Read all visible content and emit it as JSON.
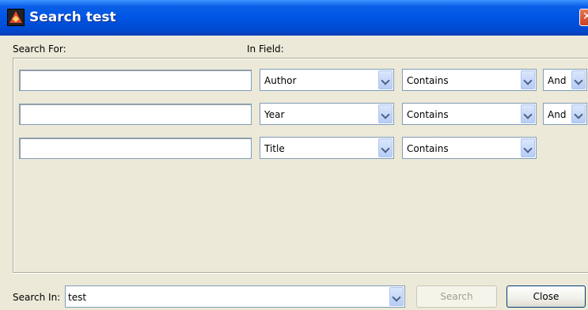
{
  "window": {
    "title": "Search test",
    "close_glyph": "✕"
  },
  "labels": {
    "search_for": "Search For:",
    "in_field": "In Field:",
    "search_in": "Search In:"
  },
  "criteria": [
    {
      "search_text": "",
      "field": "Author",
      "condition": "Contains",
      "connector": "And"
    },
    {
      "search_text": "",
      "field": "Year",
      "condition": "Contains",
      "connector": "And"
    },
    {
      "search_text": "",
      "field": "Title",
      "condition": "Contains"
    }
  ],
  "search_in": {
    "value": "test"
  },
  "buttons": {
    "search": "Search",
    "close": "Close"
  }
}
